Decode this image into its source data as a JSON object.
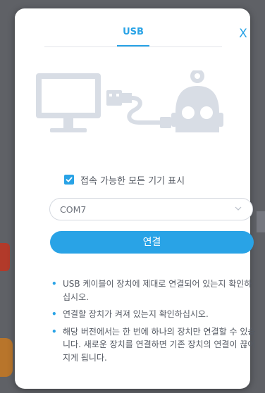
{
  "dialog": {
    "tab_label": "USB",
    "close_glyph": "X",
    "checkbox_label": "접속 가능한 모든 기기 표시",
    "checkbox_checked": true,
    "port_selected": "COM7",
    "connect_label": "연결",
    "notes": [
      "USB 케이블이 장치에 제대로 연결되어 있는지 확인하십시오.",
      "연결할 장치가 켜져 있는지 확인하십시오.",
      "해당 버전에서는 한 번에 하나의 장치만 연결할 수 있습니다. 새로운 장치를 연결하면 기존 장치의 연결이 끊어지게 됩니다."
    ]
  },
  "icons": {
    "monitor": "monitor-icon",
    "cable": "usb-cable-icon",
    "robot": "robot-icon",
    "checkbox": "check-icon",
    "dropdown": "chevron-down-icon"
  },
  "colors": {
    "accent": "#29a3e6",
    "illustration": "#d8dde5",
    "text": "#555a63"
  }
}
